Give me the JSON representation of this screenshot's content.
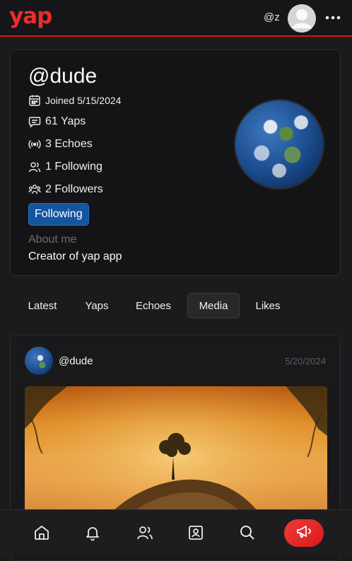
{
  "header": {
    "logo": "yap",
    "handle": "@z",
    "avatar_icon": "user-avatar-icon",
    "menu_icon": "more-horizontal-icon"
  },
  "profile": {
    "name": "@dude",
    "joined": "Joined 5/15/2024",
    "yaps": "61 Yaps",
    "echoes": "3 Echoes",
    "following": "1 Following",
    "followers": "2 Followers",
    "follow_button": "Following",
    "about_label": "About me",
    "about_text": "Creator of yap app"
  },
  "tabs": [
    "Latest",
    "Yaps",
    "Echoes",
    "Media",
    "Likes"
  ],
  "active_tab": "Media",
  "post": {
    "user": "@dude",
    "date": "5/20/2024"
  },
  "bottom_nav": [
    "home-icon",
    "bell-icon",
    "users-icon",
    "profile-icon",
    "search-icon",
    "megaphone-icon"
  ],
  "colors": {
    "brand": "#ef2b2b",
    "follow_button": "#1455a0",
    "background": "#1b1b1d"
  }
}
